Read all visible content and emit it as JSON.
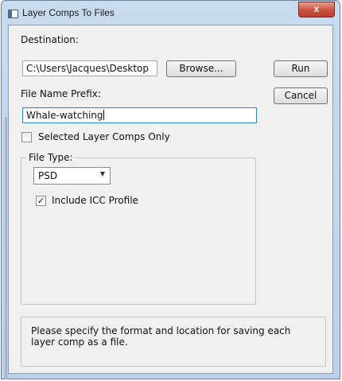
{
  "window": {
    "title": "Layer Comps To Files",
    "close_glyph": "x"
  },
  "destination": {
    "label": "Destination:",
    "value": "C:\\Users\\Jacques\\Desktop",
    "browse_label": "Browse..."
  },
  "prefix": {
    "label": "File Name Prefix:",
    "value": "Whale-watching"
  },
  "selected_only": {
    "label": "Selected Layer Comps Only",
    "checked": false
  },
  "file_type": {
    "legend": "File Type:",
    "selected": "PSD",
    "include_icc": {
      "label": "Include ICC Profile",
      "checked": true,
      "mark": "✓"
    }
  },
  "actions": {
    "run_label": "Run",
    "cancel_label": "Cancel"
  },
  "message": "Please specify the format and location for saving each layer comp as a file."
}
